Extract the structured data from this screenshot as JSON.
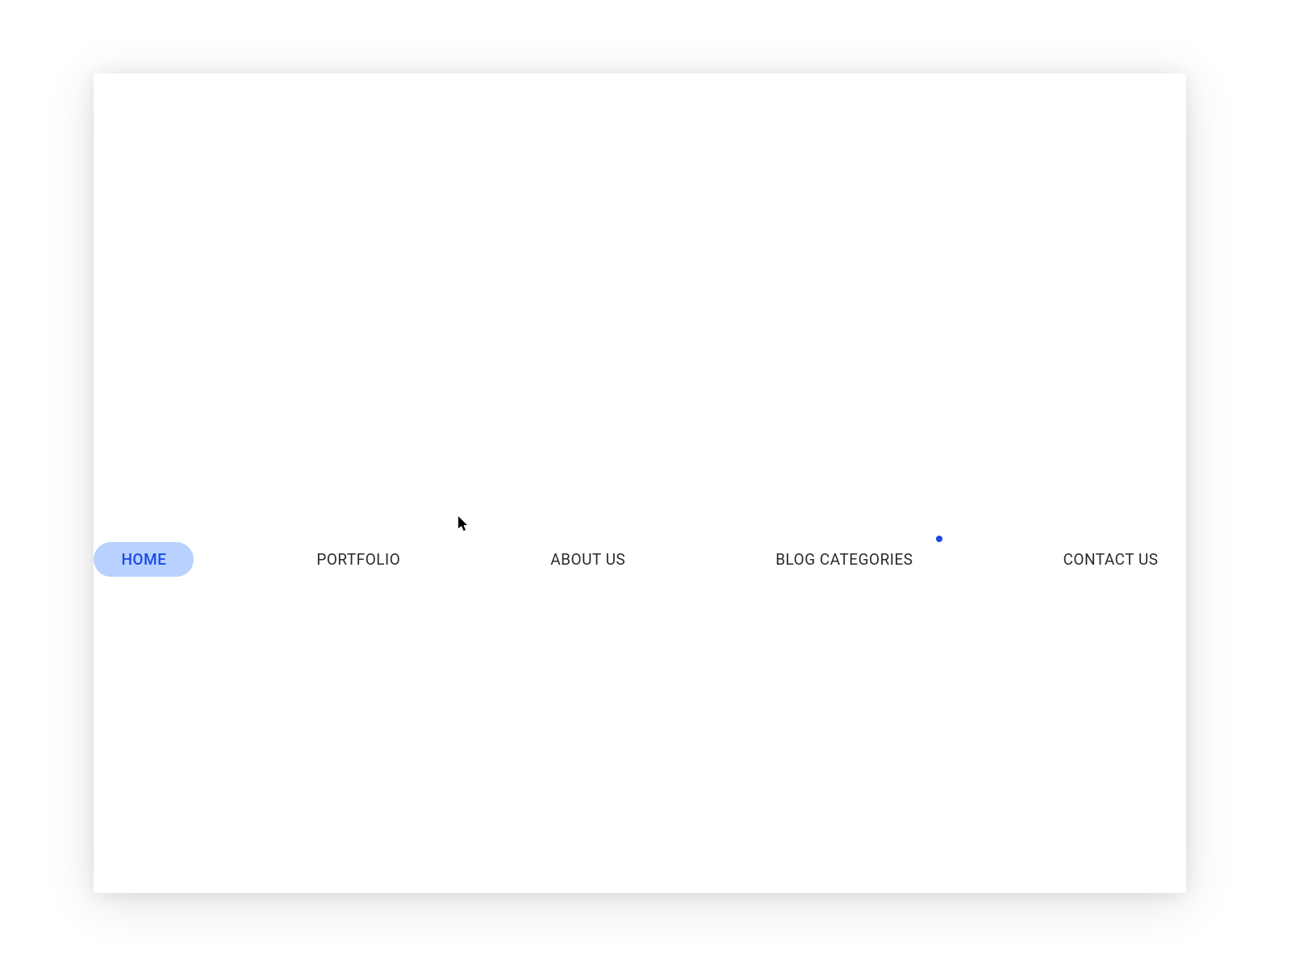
{
  "nav": {
    "items": [
      {
        "label": "HOME",
        "active": true,
        "has_dot": false
      },
      {
        "label": "PORTFOLIO",
        "active": false,
        "has_dot": false
      },
      {
        "label": "ABOUT US",
        "active": false,
        "has_dot": false
      },
      {
        "label": "BLOG CATEGORIES",
        "active": false,
        "has_dot": true
      },
      {
        "label": "CONTACT US",
        "active": false,
        "has_dot": false
      }
    ]
  },
  "colors": {
    "active_bg": "#b8d1ff",
    "active_text": "#1a4ae8",
    "text": "#2a2a2a",
    "dot": "#1a4ae8"
  }
}
